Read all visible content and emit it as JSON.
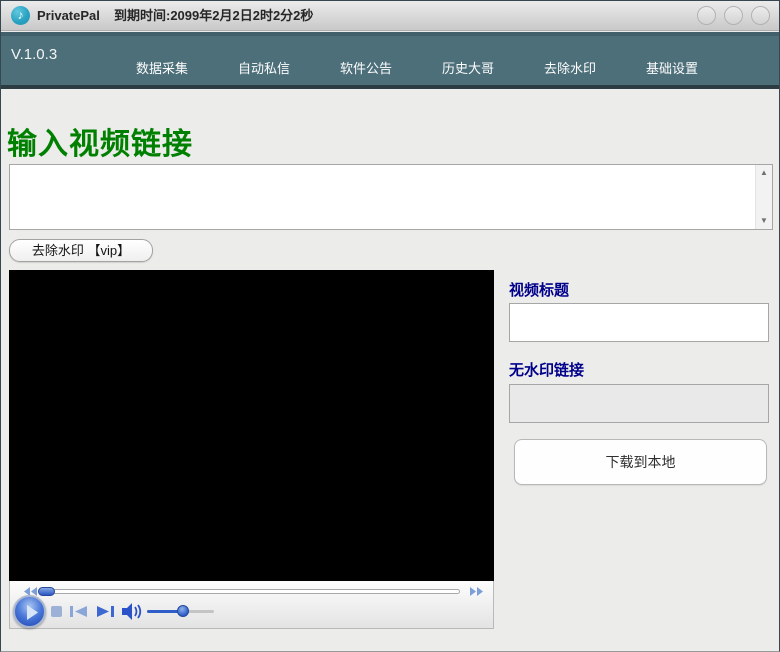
{
  "window": {
    "app_title": "PrivatePal",
    "expiry_text": "到期时间:2099年2月2日2时2分2秒",
    "app_icon_glyph": "♪"
  },
  "nav": {
    "version": "V.1.0.3",
    "items": [
      {
        "label": "数据采集"
      },
      {
        "label": "自动私信"
      },
      {
        "label": "软件公告"
      },
      {
        "label": "历史大哥"
      },
      {
        "label": "去除水印"
      },
      {
        "label": "基础设置"
      }
    ]
  },
  "main": {
    "heading": "输入视频链接",
    "video_link_value": "",
    "vip_button_label": "去除水印 【vip】",
    "scroll_up_glyph": "▲",
    "scroll_down_glyph": "▼"
  },
  "right_panel": {
    "video_title_label": "视频标题",
    "video_title_value": "",
    "no_watermark_label": "无水印链接",
    "no_watermark_value": "",
    "download_button_label": "下载到本地"
  },
  "colors": {
    "navbar_teal": "#4d6f7a",
    "navbar_bottom_strip": "#2d3c43",
    "heading_green": "#008000",
    "label_navy": "#00008b",
    "app_icon_teal": "#2aa3c2",
    "player_blue": "#2b52c9",
    "video_background": "#000000"
  }
}
